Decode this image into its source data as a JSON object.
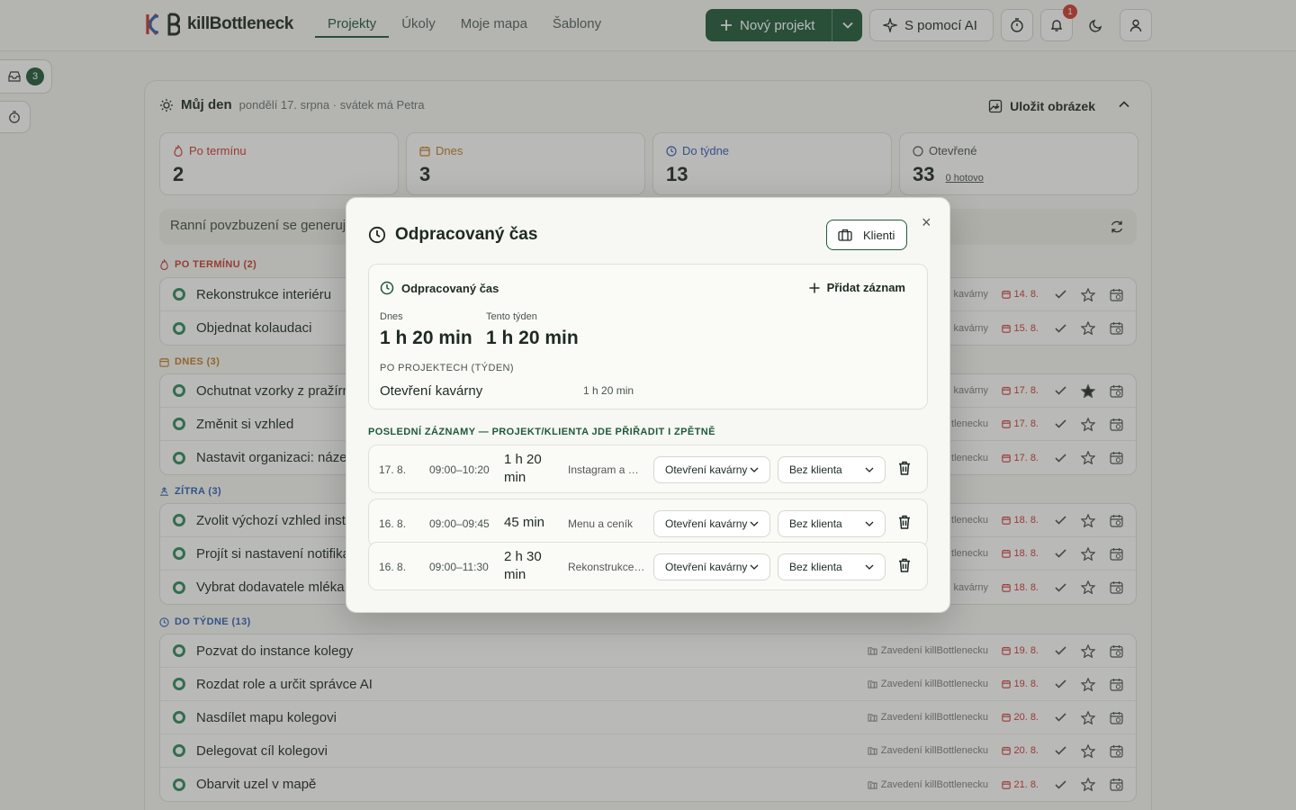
{
  "app": {
    "logo_mark": "KB",
    "logo_text": "killBottleneck"
  },
  "nav": {
    "items": [
      {
        "label": "Projekty",
        "active": true
      },
      {
        "label": "Úkoly",
        "active": false
      },
      {
        "label": "Moje mapa",
        "active": false
      },
      {
        "label": "Šablony",
        "active": false
      }
    ]
  },
  "header": {
    "new_project_label": "Nový projekt",
    "ai_label": "S pomocí AI",
    "notifications_count": "1"
  },
  "rail": {
    "inbox_count": "3"
  },
  "day": {
    "title": "Můj den",
    "date_text": "pondělí 17. srpna · svátek má Petra",
    "save_image_label": "Uložit obrázek",
    "stats": [
      {
        "label": "Po termínu",
        "value": "2",
        "color": "#cc3a30",
        "icon": "flame-icon"
      },
      {
        "label": "Dnes",
        "value": "3",
        "color": "#c07a22",
        "icon": "calendar-icon"
      },
      {
        "label": "Do týdne",
        "value": "13",
        "color": "#2f5fb5",
        "icon": "clock-icon"
      },
      {
        "label": "Otevřené",
        "value": "33",
        "sub": "0 hotovo",
        "color": "#4a544e",
        "icon": "circle-icon"
      }
    ],
    "motivation": "Ranní povzbuzení se generuje…"
  },
  "sections": {
    "overdue": {
      "label": "PO TERMÍNU (2)",
      "color": "#cc3a30"
    },
    "today": {
      "label": "DNES (3)",
      "color": "#c07a22"
    },
    "tomorrow": {
      "label": "ZÍTRA (3)",
      "color": "#2f5fb5"
    },
    "week": {
      "label": "DO TÝDNE (13)",
      "color": "#2f5fb5"
    }
  },
  "tasks": {
    "overdue": [
      {
        "title": "Rekonstrukce interiéru",
        "project": "kavárny",
        "due": "14. 8.",
        "starred": false
      },
      {
        "title": "Objednat kolaudaci",
        "project": "kavárny",
        "due": "15. 8.",
        "starred": false
      }
    ],
    "today": [
      {
        "title": "Ochutnat vzorky z pražírny",
        "project": "kavárny",
        "due": "17. 8.",
        "starred": true
      },
      {
        "title": "Změnit si vzhled",
        "project": "tlenecku",
        "due": "17. 8.",
        "starred": false
      },
      {
        "title": "Nastavit organizaci: název",
        "project": "tlenecku",
        "due": "17. 8.",
        "starred": false
      }
    ],
    "tomorrow": [
      {
        "title": "Zvolit výchozí vzhled instance",
        "project": "tlenecku",
        "due": "18. 8.",
        "starred": false
      },
      {
        "title": "Projít si nastavení notifikací",
        "project": "tlenecku",
        "due": "18. 8.",
        "starred": false
      },
      {
        "title": "Vybrat dodavatele mléka",
        "project": "kavárny",
        "due": "18. 8.",
        "starred": false
      }
    ],
    "week": [
      {
        "title": "Pozvat do instance kolegy",
        "project": "Zavedení killBottlenecku",
        "due": "19. 8.",
        "starred": false
      },
      {
        "title": "Rozdat role a určit správce AI",
        "project": "Zavedení killBottlenecku",
        "due": "19. 8.",
        "starred": false
      },
      {
        "title": "Nasdílet mapu kolegovi",
        "project": "Zavedení killBottlenecku",
        "due": "20. 8.",
        "starred": false
      },
      {
        "title": "Delegovat cíl kolegovi",
        "project": "Zavedení killBottlenecku",
        "due": "20. 8.",
        "starred": false
      },
      {
        "title": "Obarvit uzel v mapě",
        "project": "Zavedení killBottlenecku",
        "due": "21. 8.",
        "starred": false
      }
    ]
  },
  "modal": {
    "title": "Odpracovaný čas",
    "clients_label": "Klienti",
    "close_label": "×",
    "panel_title": "Odpracovaný čas",
    "add_entry_label": "Přidat záznam",
    "today_label": "Dnes",
    "today_value": "1 h 20 min",
    "week_label": "Tento týden",
    "week_value": "1 h 20 min",
    "by_project_label": "PO PROJEKTECH (TÝDEN)",
    "by_project": [
      {
        "name": "Otevření kavárny",
        "time": "1 h 20 min"
      }
    ],
    "recent_label": "POSLEDNÍ ZÁZNAMY — PROJEKT/KLIENTA JDE PŘIŘADIT I ZPĚTNĚ",
    "entries": [
      {
        "date": "17. 8.",
        "range": "09:00–10:20",
        "duration": "1 h 20 min",
        "note": "Instagram a …",
        "project": "Otevření kavárny",
        "client": "Bez klienta"
      },
      {
        "date": "16. 8.",
        "range": "09:00–09:45",
        "duration": "45 min",
        "note": "Menu a ceník",
        "project": "Otevření kavárny",
        "client": "Bez klienta"
      },
      {
        "date": "16. 8.",
        "range": "09:00–11:30",
        "duration": "2 h 30 min",
        "note": "Rekonstrukce…",
        "project": "Otevření kavárny",
        "client": "Bez klienta"
      }
    ]
  },
  "colors": {
    "accent": "#1e5a39",
    "danger": "#cc3a30"
  }
}
